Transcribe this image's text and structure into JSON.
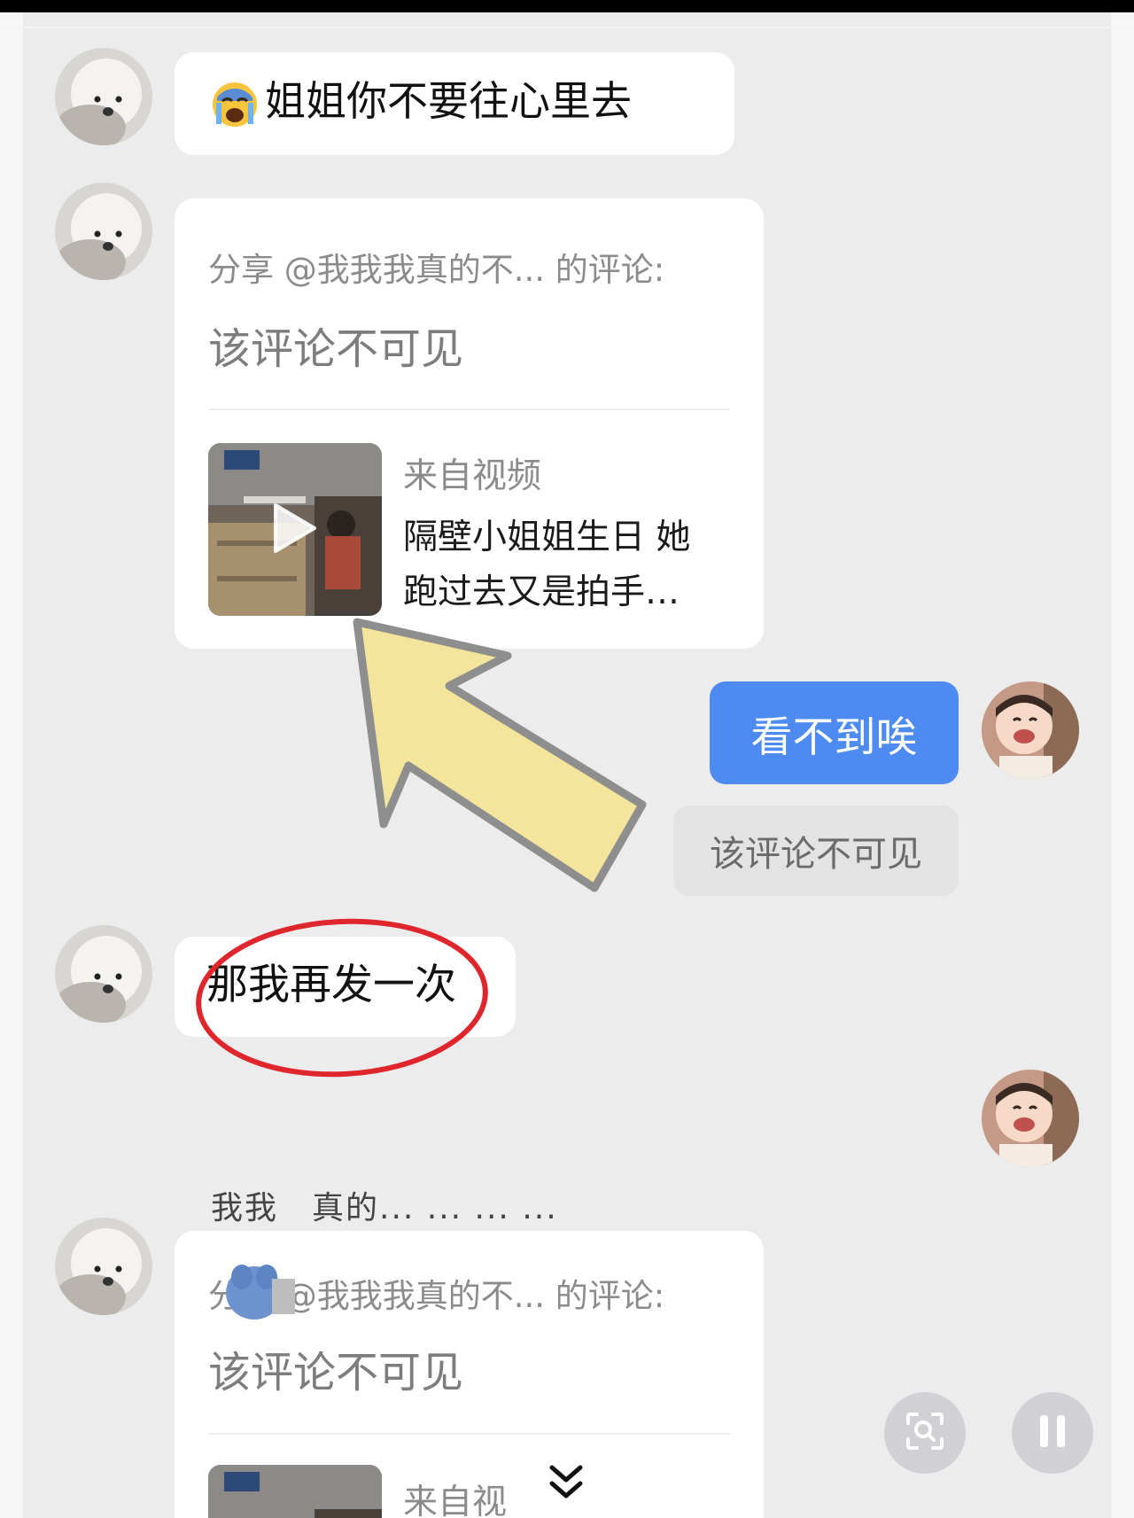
{
  "messages": [
    {
      "side": "left",
      "type": "text",
      "emoji": "loudly-crying-face",
      "text": "姐姐你不要往心里去"
    },
    {
      "side": "left",
      "type": "shared_comment",
      "share_line": "分享 @我我我真的不... 的评论:",
      "hidden_text": "该评论不可见",
      "source_label": "来自视频",
      "video_title": "隔壁小姐姐生日 她跑过去又是拍手…"
    },
    {
      "side": "right",
      "type": "text",
      "text": "看不到唉"
    },
    {
      "side": "right",
      "type": "quote",
      "text": "该评论不可见"
    },
    {
      "side": "left",
      "type": "text",
      "text": "那我再发一次"
    },
    {
      "side": "left",
      "type": "shared_comment",
      "share_line": "分享 @我我我真的不... 的评论:",
      "hidden_text": "该评论不可见",
      "source_label": "来自视"
    }
  ],
  "garbled_overlay": "我我　真的... ... ... ...",
  "annotations": {
    "arrow_color": "#f3e59b",
    "circle_color": "#e0262d"
  },
  "colors": {
    "sent_bubble": "#4e8bf0",
    "background": "#ececed"
  },
  "controls": {
    "lens": "image-search-icon",
    "pause": "pause-icon",
    "scroll": "chevron-double-down-icon"
  }
}
